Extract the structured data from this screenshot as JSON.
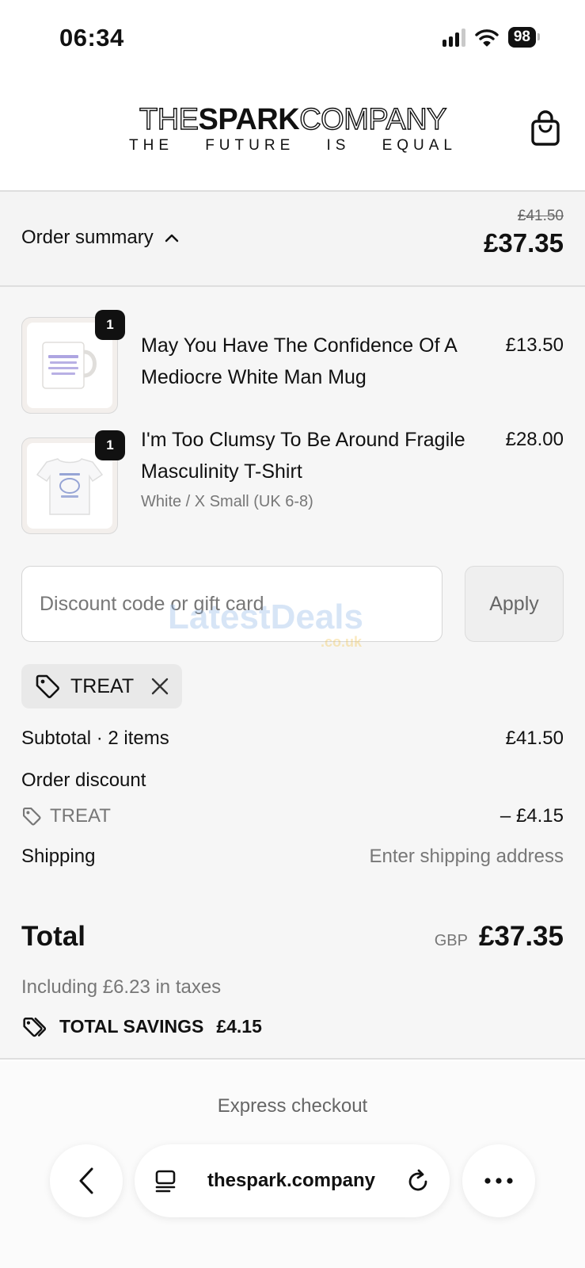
{
  "status_bar": {
    "time": "06:34",
    "battery": "98"
  },
  "brand": {
    "name_outline_1": "THE",
    "name_solid": "SPARK",
    "name_outline_2": "COMPANY",
    "tagline": [
      "THE",
      "FUTURE",
      "IS",
      "EQUAL"
    ]
  },
  "summary": {
    "label": "Order summary",
    "original_price": "£41.50",
    "price": "£37.35"
  },
  "products": [
    {
      "quantity": "1",
      "name": "May You Have The Confidence Of A Mediocre White Man Mug",
      "variant": "",
      "price": "£13.50",
      "thumb_text": "May you have the confidence of a mediocre white man."
    },
    {
      "quantity": "1",
      "name": "I'm Too Clumsy To Be Around Fragile Masculinity T-Shirt",
      "variant": "White / X Small (UK 6-8)",
      "price": "£28.00"
    }
  ],
  "discount": {
    "placeholder": "Discount code or gift card",
    "apply_label": "Apply",
    "applied_code": "TREAT"
  },
  "watermark": {
    "text": "LatestDeals",
    "sub": ".co.uk"
  },
  "totals": {
    "subtotal_label": "Subtotal · 2 items",
    "subtotal_value": "£41.50",
    "order_discount_label": "Order discount",
    "discount_code": "TREAT",
    "discount_value": "– £4.15",
    "shipping_label": "Shipping",
    "shipping_value": "Enter shipping address",
    "total_label": "Total",
    "currency": "GBP",
    "total_value": "£37.35",
    "taxes": "Including £6.23 in taxes",
    "savings_label": "TOTAL SAVINGS",
    "savings_value": "£4.15"
  },
  "express_checkout": "Express checkout",
  "browser": {
    "url": "thespark.company"
  }
}
